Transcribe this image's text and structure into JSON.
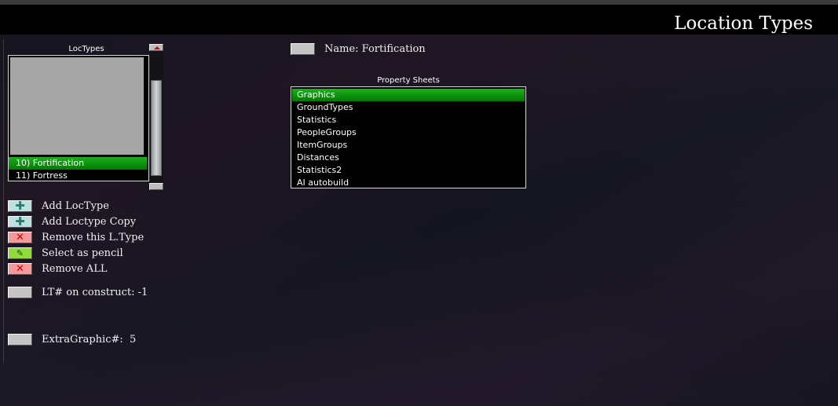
{
  "window": {
    "title": "Location Types"
  },
  "loctypes": {
    "label": "LocTypes",
    "items": [
      {
        "label": "10) Fortification",
        "selected": true
      },
      {
        "label": "11) Fortress",
        "selected": false
      }
    ]
  },
  "actions": [
    {
      "name": "add-loctype",
      "icon": "plus-icon",
      "glyph": "✚",
      "label": "Add LocType"
    },
    {
      "name": "add-loctype-copy",
      "icon": "plus-icon",
      "glyph": "✚",
      "label": "Add Loctype Copy"
    },
    {
      "name": "remove-this-ltype",
      "icon": "close-icon",
      "glyph": "✕",
      "label": "Remove this L.Type"
    },
    {
      "name": "select-as-pencil",
      "icon": "pencil-icon",
      "glyph": "✎",
      "label": "Select as pencil"
    },
    {
      "name": "remove-all",
      "icon": "close-icon",
      "glyph": "✕",
      "label": "Remove ALL"
    }
  ],
  "lt_on_construct": {
    "label": "LT# on construct: -1"
  },
  "extra_graphic": {
    "label": "ExtraGraphic#:  5"
  },
  "name_field": {
    "label": "Name: Fortification"
  },
  "property_sheets": {
    "label": "Property Sheets",
    "items": [
      {
        "label": "Graphics",
        "selected": true
      },
      {
        "label": "GroundTypes",
        "selected": false
      },
      {
        "label": "Statistics",
        "selected": false
      },
      {
        "label": "PeopleGroups",
        "selected": false
      },
      {
        "label": "ItemGroups",
        "selected": false
      },
      {
        "label": "Distances",
        "selected": false
      },
      {
        "label": "Statistics2",
        "selected": false
      },
      {
        "label": "AI autobuild",
        "selected": false
      }
    ]
  },
  "colors": {
    "selection_green": "#00a000",
    "title_bar": "#000000",
    "background": "#16161e"
  }
}
